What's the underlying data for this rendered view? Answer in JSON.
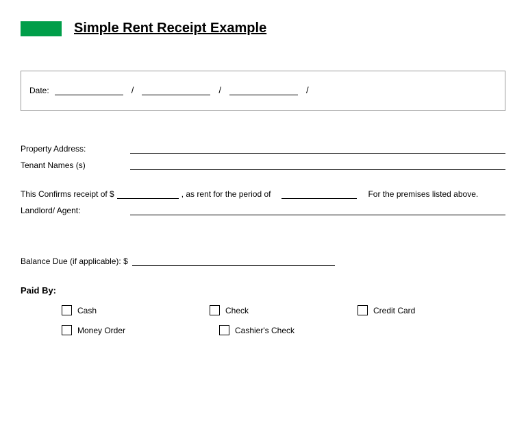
{
  "title": "Simple Rent Receipt Example",
  "dateLabel": "Date:",
  "propertyAddressLabel": "Property Address:",
  "tenantNamesLabel": "Tenant Names (s)",
  "confirm": {
    "part1": "This Confirms receipt of $",
    "part2": ", as rent for the period of",
    "part3": "For the premises listed above."
  },
  "landlordLabel": "Landlord/ Agent:",
  "balanceLabel": "Balance Due (if applicable):  $",
  "paidByLabel": "Paid By:",
  "payMethods": {
    "cash": "Cash",
    "check": "Check",
    "creditCard": "Credit Card",
    "moneyOrder": "Money Order",
    "cashiersCheck": "Cashier's Check"
  }
}
